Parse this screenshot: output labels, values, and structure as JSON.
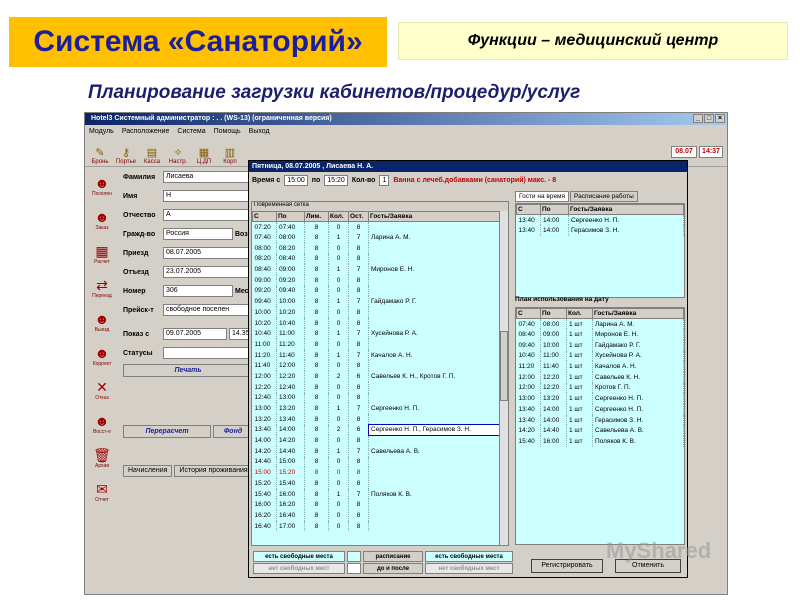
{
  "slide": {
    "title": "Система «Санаторий»",
    "subtitle": "Функции – медицинский центр",
    "heading": "Планирование загрузки кабинетов/процедур/услуг",
    "watermark": "MyShared"
  },
  "app": {
    "titlebar": "Hotel3  Системный администратор : . . (WS-13) (ограниченная версия)",
    "menu": [
      "Модуль",
      "Расположение",
      "Система",
      "Помощь",
      "Выход"
    ],
    "toolbar": [
      "Бронь",
      "Портье",
      "Касса",
      "Настр.",
      "Ц.ДП",
      "Корп"
    ],
    "date": "08.07",
    "time": "14:37",
    "leftbar": [
      "Поселен",
      "Заказ",
      "Расчет",
      "Переезд",
      "Выезд",
      "Коррект",
      "Отказ",
      "Восст-е",
      "Архив",
      "Отчет"
    ],
    "form": {
      "surname_label": "Фамилия",
      "surname": "Лисаева",
      "name_label": "Имя",
      "name": "Н",
      "patronymic_label": "Отчество",
      "patronymic": "А",
      "country_label": "Гражд-во",
      "country": "Россия",
      "country_extra": "Возр",
      "arrival_label": "Приезд",
      "arrival": "08.07.2005",
      "departure_label": "Отъезд",
      "departure": "23.07.2005",
      "room_label": "Номер",
      "room": "306",
      "place_label": "Мест",
      "price_label": "Прейск-т",
      "price": "свободное поселен",
      "show_label": "Показ с",
      "show_date": "09.07.2005",
      "show_time": "14.35",
      "status_label": "Статусы",
      "print": "Печать",
      "recalc": "Перерасчет",
      "fund": "Фонд",
      "tab1": "Начисления",
      "tab2": "История проживания"
    }
  },
  "dialog": {
    "title": "Пятница, 08.07.2005 , Лисаева Н. А.",
    "time_from_label": "Время с",
    "time_from": "15:00",
    "time_to_label": "по",
    "time_to": "15:20",
    "count_label": "Кол-во",
    "count": "1",
    "service": "Ванна с лечеб.добавками (санаторий) макс. - 8",
    "grid_caption": "Повременная сетка",
    "columns": [
      "С",
      "По",
      "Лим.",
      "Кол.",
      "Ост.",
      "Гость/Заявка"
    ],
    "rows": [
      [
        "07:20",
        "07:40",
        "8",
        "0",
        "8",
        ""
      ],
      [
        "07:40",
        "08:00",
        "8",
        "1",
        "7",
        "Ларина А. М."
      ],
      [
        "08:00",
        "08:20",
        "8",
        "0",
        "8",
        ""
      ],
      [
        "08:20",
        "08:40",
        "8",
        "0",
        "8",
        ""
      ],
      [
        "08:40",
        "09:00",
        "8",
        "1",
        "7",
        "Миронов Е. Н."
      ],
      [
        "09:00",
        "09:20",
        "8",
        "0",
        "8",
        ""
      ],
      [
        "09:20",
        "09:40",
        "8",
        "0",
        "8",
        ""
      ],
      [
        "09:40",
        "10:00",
        "8",
        "1",
        "7",
        "Гайдамако Р. Г."
      ],
      [
        "10:00",
        "10:20",
        "8",
        "0",
        "8",
        ""
      ],
      [
        "10:20",
        "10:40",
        "8",
        "0",
        "8",
        ""
      ],
      [
        "10:40",
        "11:00",
        "8",
        "1",
        "7",
        "Хусейнова Р. А."
      ],
      [
        "11:00",
        "11:20",
        "8",
        "0",
        "8",
        ""
      ],
      [
        "11:20",
        "11:40",
        "8",
        "1",
        "7",
        "Качалов А. Н."
      ],
      [
        "11:40",
        "12:00",
        "8",
        "0",
        "8",
        ""
      ],
      [
        "12:00",
        "12:20",
        "8",
        "2",
        "6",
        "Савельев К. Н., Кротов Г. П."
      ],
      [
        "12:20",
        "12:40",
        "8",
        "0",
        "8",
        ""
      ],
      [
        "12:40",
        "13:00",
        "8",
        "0",
        "8",
        ""
      ],
      [
        "13:00",
        "13:20",
        "8",
        "1",
        "7",
        "Сергеенко Н. П."
      ],
      [
        "13:20",
        "13:40",
        "8",
        "0",
        "8",
        ""
      ],
      [
        "13:40",
        "14:00",
        "8",
        "2",
        "6",
        "Сергеенко Н. П., Герасимов З. Н."
      ],
      [
        "14:00",
        "14:20",
        "8",
        "0",
        "8",
        ""
      ],
      [
        "14:20",
        "14:40",
        "8",
        "1",
        "7",
        "Савельева А. В."
      ],
      [
        "14:40",
        "15:00",
        "8",
        "0",
        "8",
        ""
      ],
      [
        "15:00",
        "15:20",
        "8",
        "0",
        "8",
        ""
      ],
      [
        "15:20",
        "15:40",
        "8",
        "0",
        "8",
        ""
      ],
      [
        "15:40",
        "16:00",
        "8",
        "1",
        "7",
        "Поляков К. В."
      ],
      [
        "16:00",
        "16:20",
        "8",
        "0",
        "8",
        ""
      ],
      [
        "16:20",
        "16:40",
        "8",
        "0",
        "8",
        ""
      ],
      [
        "16:40",
        "17:00",
        "8",
        "0",
        "8",
        ""
      ]
    ],
    "highlight_row": 23,
    "tab_guests": "Гости на время",
    "tab_schedule": "Расписание работы",
    "guests_columns": [
      "С",
      "По",
      "Гость/Заявка"
    ],
    "guests": [
      [
        "13:40",
        "14:00",
        "Сергеенко Н. П."
      ],
      [
        "13:40",
        "14:00",
        "Герасимов З. Н."
      ]
    ],
    "plan_caption": "План использования на дату",
    "plan_columns": [
      "С",
      "По",
      "Кол.",
      "Гость/Заявка"
    ],
    "plan": [
      [
        "07:40",
        "08:00",
        "1 шт",
        "Ларина А. М."
      ],
      [
        "08:40",
        "09:00",
        "1 шт",
        "Миронов Е. Н."
      ],
      [
        "09:40",
        "10:00",
        "1 шт",
        "Гайдамако Р. Г."
      ],
      [
        "10:40",
        "11:00",
        "1 шт",
        "Хусейнова Р. А."
      ],
      [
        "11:20",
        "11:40",
        "1 шт",
        "Качалов А. Н."
      ],
      [
        "12:00",
        "12:20",
        "1 шт",
        "Савельев К. Н."
      ],
      [
        "12:00",
        "12:20",
        "1 шт",
        "Кротов Г. П."
      ],
      [
        "13:00",
        "13:20",
        "1 шт",
        "Сергеенко Н. П."
      ],
      [
        "13:40",
        "14:00",
        "1 шт",
        "Сергеенко Н. П."
      ],
      [
        "13:40",
        "14:00",
        "1 шт",
        "Герасимов З. Н."
      ],
      [
        "14:20",
        "14:40",
        "1 шт",
        "Савельева А. В."
      ],
      [
        "15:40",
        "16:00",
        "1 шт",
        "Поляков К. В."
      ]
    ],
    "legend": {
      "free": "есть свободные места",
      "nofree": "нет свободных мест",
      "schedule": "расписание",
      "before_after": "до и после",
      "free2": "есть свободные места",
      "nofree2": "нет свободных мест"
    },
    "register": "Регистрировать",
    "cancel": "Отменить"
  }
}
